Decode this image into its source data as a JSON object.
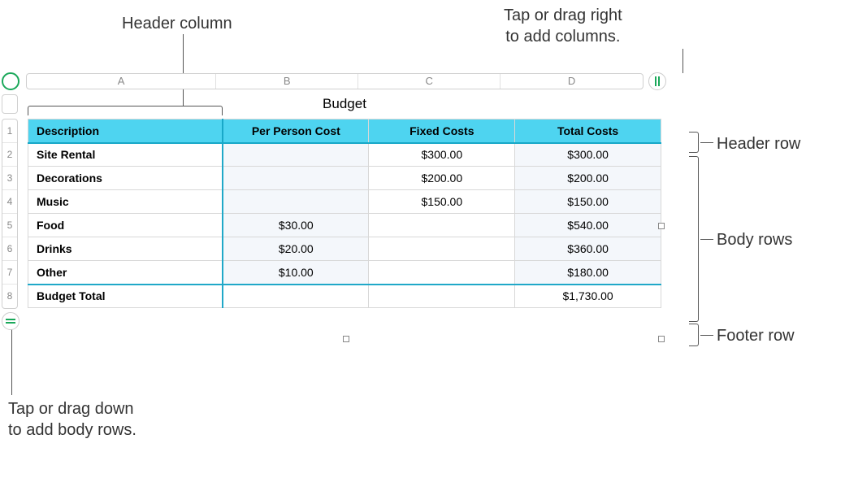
{
  "callouts": {
    "header_column": "Header column",
    "add_columns": "Tap or drag right\nto add columns.",
    "header_row": "Header row",
    "body_rows": "Body rows",
    "footer_row": "Footer row",
    "add_rows": "Tap or drag down\nto add body rows."
  },
  "columns": [
    "A",
    "B",
    "C",
    "D"
  ],
  "rows": [
    "1",
    "2",
    "3",
    "4",
    "5",
    "6",
    "7",
    "8"
  ],
  "table": {
    "title": "Budget",
    "headers": [
      "Description",
      "Per Person Cost",
      "Fixed Costs",
      "Total Costs"
    ],
    "body": [
      {
        "desc": "Site Rental",
        "pp": "",
        "fixed": "$300.00",
        "total": "$300.00"
      },
      {
        "desc": "Decorations",
        "pp": "",
        "fixed": "$200.00",
        "total": "$200.00"
      },
      {
        "desc": "Music",
        "pp": "",
        "fixed": "$150.00",
        "total": "$150.00"
      },
      {
        "desc": "Food",
        "pp": "$30.00",
        "fixed": "",
        "total": "$540.00"
      },
      {
        "desc": "Drinks",
        "pp": "$20.00",
        "fixed": "",
        "total": "$360.00"
      },
      {
        "desc": "Other",
        "pp": "$10.00",
        "fixed": "",
        "total": "$180.00"
      }
    ],
    "footer": {
      "desc": "Budget Total",
      "pp": "",
      "fixed": "",
      "total": "$1,730.00"
    }
  }
}
